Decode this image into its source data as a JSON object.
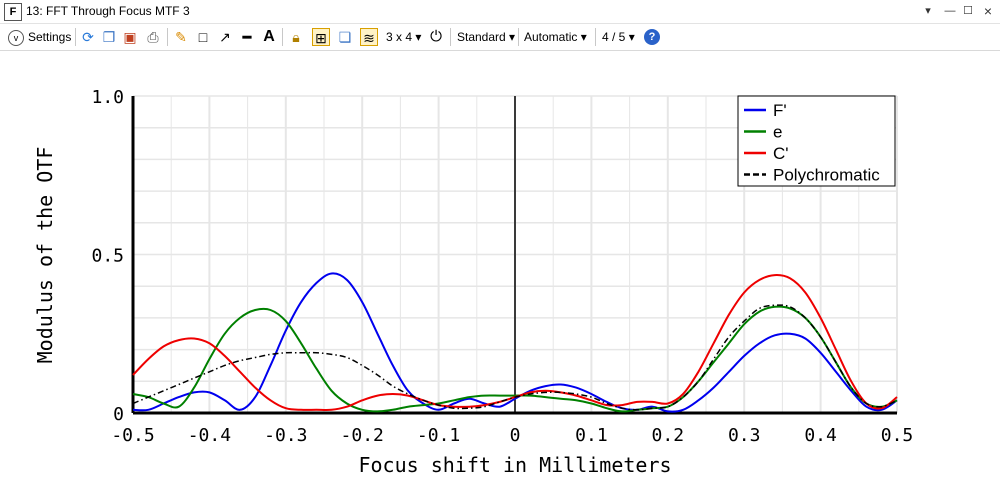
{
  "window": {
    "title": "13: FFT Through Focus MTF 3",
    "app_icon_letter": "F"
  },
  "toolbar": {
    "settings_label": "Settings",
    "layout_label": "3 x 4",
    "scale_label": "Standard",
    "auto_label": "Automatic",
    "page_label": "4 / 5"
  },
  "colors": {
    "F_prime": "#0000ee",
    "e": "#008000",
    "C_prime": "#ee0000",
    "polychromatic": "#000000",
    "grid": "#e6e6e6",
    "active_toolbar_border": "#d8a000"
  },
  "chart_data": {
    "type": "line",
    "xlabel": "Focus shift in Millimeters",
    "ylabel": "Modulus of the OTF",
    "xlim": [
      -0.5,
      0.5
    ],
    "ylim": [
      0,
      1.0
    ],
    "x_ticks": [
      "-0.5",
      "-0.4",
      "-0.3",
      "-0.2",
      "-0.1",
      "0",
      "0.1",
      "0.2",
      "0.3",
      "0.4",
      "0.5"
    ],
    "y_ticks": [
      "0",
      "0.5",
      "1.0"
    ],
    "grid": true,
    "legend_position": "top-right",
    "series": [
      {
        "name": "F'",
        "style": "solid",
        "x": [
          -0.5,
          -0.48,
          -0.46,
          -0.44,
          -0.42,
          -0.4,
          -0.38,
          -0.36,
          -0.34,
          -0.32,
          -0.3,
          -0.28,
          -0.26,
          -0.24,
          -0.22,
          -0.2,
          -0.18,
          -0.16,
          -0.14,
          -0.12,
          -0.1,
          -0.08,
          -0.06,
          -0.04,
          -0.02,
          0.0,
          0.02,
          0.04,
          0.06,
          0.08,
          0.1,
          0.12,
          0.14,
          0.16,
          0.18,
          0.2,
          0.22,
          0.24,
          0.26,
          0.28,
          0.3,
          0.32,
          0.34,
          0.36,
          0.38,
          0.4,
          0.42,
          0.44,
          0.46,
          0.48,
          0.5
        ],
        "values": [
          0.01,
          0.01,
          0.03,
          0.05,
          0.065,
          0.065,
          0.04,
          0.01,
          0.05,
          0.15,
          0.26,
          0.35,
          0.41,
          0.44,
          0.42,
          0.35,
          0.25,
          0.15,
          0.07,
          0.03,
          0.01,
          0.03,
          0.045,
          0.03,
          0.02,
          0.045,
          0.07,
          0.085,
          0.09,
          0.08,
          0.06,
          0.035,
          0.015,
          0.01,
          0.02,
          0.005,
          0.01,
          0.04,
          0.08,
          0.13,
          0.18,
          0.22,
          0.245,
          0.25,
          0.235,
          0.19,
          0.13,
          0.07,
          0.02,
          0.01,
          0.04
        ]
      },
      {
        "name": "e",
        "style": "solid",
        "x": [
          -0.5,
          -0.48,
          -0.46,
          -0.44,
          -0.42,
          -0.4,
          -0.38,
          -0.36,
          -0.34,
          -0.32,
          -0.3,
          -0.28,
          -0.26,
          -0.24,
          -0.22,
          -0.2,
          -0.18,
          -0.16,
          -0.14,
          -0.12,
          -0.1,
          -0.08,
          -0.06,
          -0.04,
          -0.02,
          0.0,
          0.02,
          0.04,
          0.06,
          0.08,
          0.1,
          0.12,
          0.14,
          0.16,
          0.18,
          0.2,
          0.22,
          0.24,
          0.26,
          0.28,
          0.3,
          0.32,
          0.34,
          0.36,
          0.38,
          0.4,
          0.42,
          0.44,
          0.46,
          0.48,
          0.5
        ],
        "values": [
          0.06,
          0.05,
          0.03,
          0.02,
          0.08,
          0.17,
          0.25,
          0.3,
          0.325,
          0.325,
          0.29,
          0.22,
          0.14,
          0.07,
          0.03,
          0.01,
          0.005,
          0.01,
          0.02,
          0.025,
          0.03,
          0.04,
          0.05,
          0.055,
          0.055,
          0.055,
          0.055,
          0.05,
          0.045,
          0.04,
          0.03,
          0.015,
          0.005,
          0.01,
          0.015,
          0.02,
          0.05,
          0.1,
          0.16,
          0.22,
          0.28,
          0.32,
          0.335,
          0.33,
          0.3,
          0.24,
          0.16,
          0.08,
          0.03,
          0.02,
          0.04
        ]
      },
      {
        "name": "C'",
        "style": "solid",
        "x": [
          -0.5,
          -0.48,
          -0.46,
          -0.44,
          -0.42,
          -0.4,
          -0.38,
          -0.36,
          -0.34,
          -0.32,
          -0.3,
          -0.28,
          -0.26,
          -0.24,
          -0.22,
          -0.2,
          -0.18,
          -0.16,
          -0.14,
          -0.12,
          -0.1,
          -0.08,
          -0.06,
          -0.04,
          -0.02,
          0.0,
          0.02,
          0.04,
          0.06,
          0.08,
          0.1,
          0.12,
          0.14,
          0.16,
          0.18,
          0.2,
          0.22,
          0.24,
          0.26,
          0.28,
          0.3,
          0.32,
          0.34,
          0.36,
          0.38,
          0.4,
          0.42,
          0.44,
          0.46,
          0.48,
          0.5
        ],
        "values": [
          0.12,
          0.17,
          0.21,
          0.23,
          0.235,
          0.22,
          0.18,
          0.13,
          0.08,
          0.04,
          0.015,
          0.01,
          0.01,
          0.01,
          0.02,
          0.04,
          0.055,
          0.06,
          0.055,
          0.04,
          0.025,
          0.02,
          0.02,
          0.025,
          0.035,
          0.05,
          0.065,
          0.07,
          0.065,
          0.055,
          0.04,
          0.025,
          0.025,
          0.035,
          0.035,
          0.03,
          0.06,
          0.13,
          0.22,
          0.31,
          0.38,
          0.42,
          0.435,
          0.425,
          0.38,
          0.3,
          0.2,
          0.1,
          0.03,
          0.015,
          0.05
        ]
      },
      {
        "name": "Polychromatic",
        "style": "dashed",
        "x": [
          -0.5,
          -0.48,
          -0.46,
          -0.44,
          -0.42,
          -0.4,
          -0.38,
          -0.36,
          -0.34,
          -0.32,
          -0.3,
          -0.28,
          -0.26,
          -0.24,
          -0.22,
          -0.2,
          -0.18,
          -0.16,
          -0.14,
          -0.12,
          -0.1,
          -0.08,
          -0.06,
          -0.04,
          -0.02,
          0.0,
          0.02,
          0.04,
          0.06,
          0.08,
          0.1,
          0.12,
          0.14,
          0.16,
          0.18,
          0.2,
          0.22,
          0.24,
          0.26,
          0.28,
          0.3,
          0.32,
          0.34,
          0.36,
          0.38,
          0.4,
          0.42,
          0.44,
          0.46,
          0.48,
          0.5
        ],
        "values": [
          0.03,
          0.05,
          0.07,
          0.09,
          0.11,
          0.13,
          0.15,
          0.165,
          0.175,
          0.185,
          0.19,
          0.19,
          0.19,
          0.185,
          0.175,
          0.15,
          0.12,
          0.085,
          0.06,
          0.04,
          0.025,
          0.015,
          0.015,
          0.02,
          0.035,
          0.05,
          0.06,
          0.065,
          0.065,
          0.06,
          0.05,
          0.03,
          0.015,
          0.01,
          0.015,
          0.02,
          0.05,
          0.1,
          0.17,
          0.24,
          0.29,
          0.33,
          0.34,
          0.335,
          0.3,
          0.24,
          0.16,
          0.08,
          0.03,
          0.02,
          0.04
        ]
      }
    ]
  }
}
